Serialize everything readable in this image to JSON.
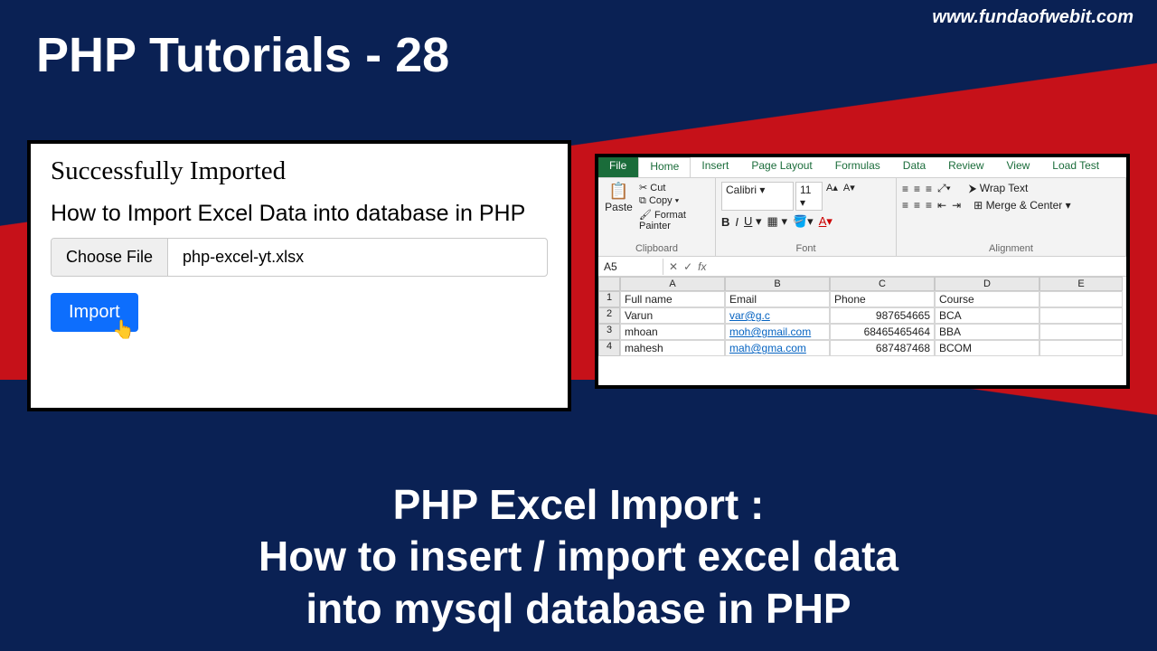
{
  "url": "www.fundaofwebit.com",
  "page_title": "PHP Tutorials - 28",
  "php_panel": {
    "success_msg": "Successfully Imported",
    "heading": "How to Import Excel Data into database in PHP",
    "choose_file_label": "Choose File",
    "file_name": "php-excel-yt.xlsx",
    "import_label": "Import"
  },
  "excel": {
    "tabs": [
      "File",
      "Home",
      "Insert",
      "Page Layout",
      "Formulas",
      "Data",
      "Review",
      "View",
      "Load Test"
    ],
    "active_tab": "Home",
    "clipboard": {
      "paste": "Paste",
      "cut": "Cut",
      "copy": "Copy",
      "format_painter": "Format Painter",
      "group_label": "Clipboard"
    },
    "font": {
      "name": "Calibri",
      "size": "11",
      "group_label": "Font"
    },
    "alignment": {
      "wrap": "Wrap Text",
      "merge": "Merge & Center",
      "group_label": "Alignment"
    },
    "cell_ref": "A5",
    "fx_label": "fx",
    "columns": [
      "A",
      "B",
      "C",
      "D",
      "E"
    ],
    "headers": [
      "Full name",
      "Email",
      "Phone",
      "Course"
    ],
    "rows": [
      {
        "n": "1",
        "c": [
          "Full name",
          "Email",
          "Phone",
          "Course",
          ""
        ]
      },
      {
        "n": "2",
        "c": [
          "Varun",
          "var@g.c",
          "987654665",
          "BCA",
          ""
        ]
      },
      {
        "n": "3",
        "c": [
          "mhoan",
          "moh@gmail.com",
          "68465465464",
          "BBA",
          ""
        ]
      },
      {
        "n": "4",
        "c": [
          "mahesh",
          "mah@gma.com",
          "687487468",
          "BCOM",
          ""
        ]
      }
    ]
  },
  "caption_lines": [
    "PHP Excel Import :",
    "How to insert / import excel data",
    "into mysql database in PHP"
  ]
}
